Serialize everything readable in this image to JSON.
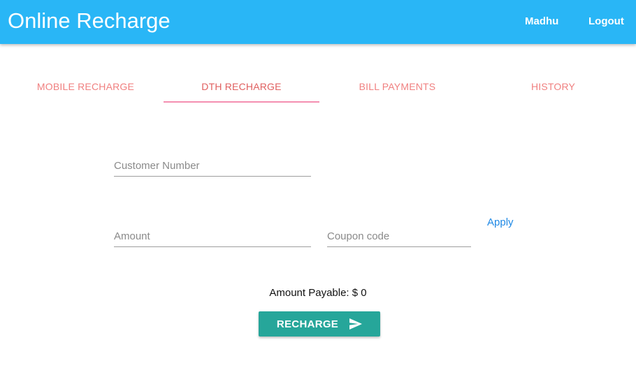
{
  "appbar": {
    "title": "Online Recharge",
    "user": "Madhu",
    "logout": "Logout",
    "color": "#29b6f6"
  },
  "tabs": [
    {
      "label": "MOBILE RECHARGE",
      "active": false
    },
    {
      "label": "DTH RECHARGE",
      "active": true
    },
    {
      "label": "BILL PAYMENTS",
      "active": false
    },
    {
      "label": "HISTORY",
      "active": false
    }
  ],
  "form": {
    "customer_number": {
      "placeholder": "Customer Number",
      "value": ""
    },
    "amount": {
      "placeholder": "Amount",
      "value": ""
    },
    "coupon": {
      "placeholder": "Coupon code",
      "value": ""
    },
    "apply_label": "Apply",
    "amount_payable": "Amount Payable: $ 0",
    "recharge_label": "RECHARGE",
    "recharge_icon": "send-icon",
    "button_color": "#26a69a"
  }
}
